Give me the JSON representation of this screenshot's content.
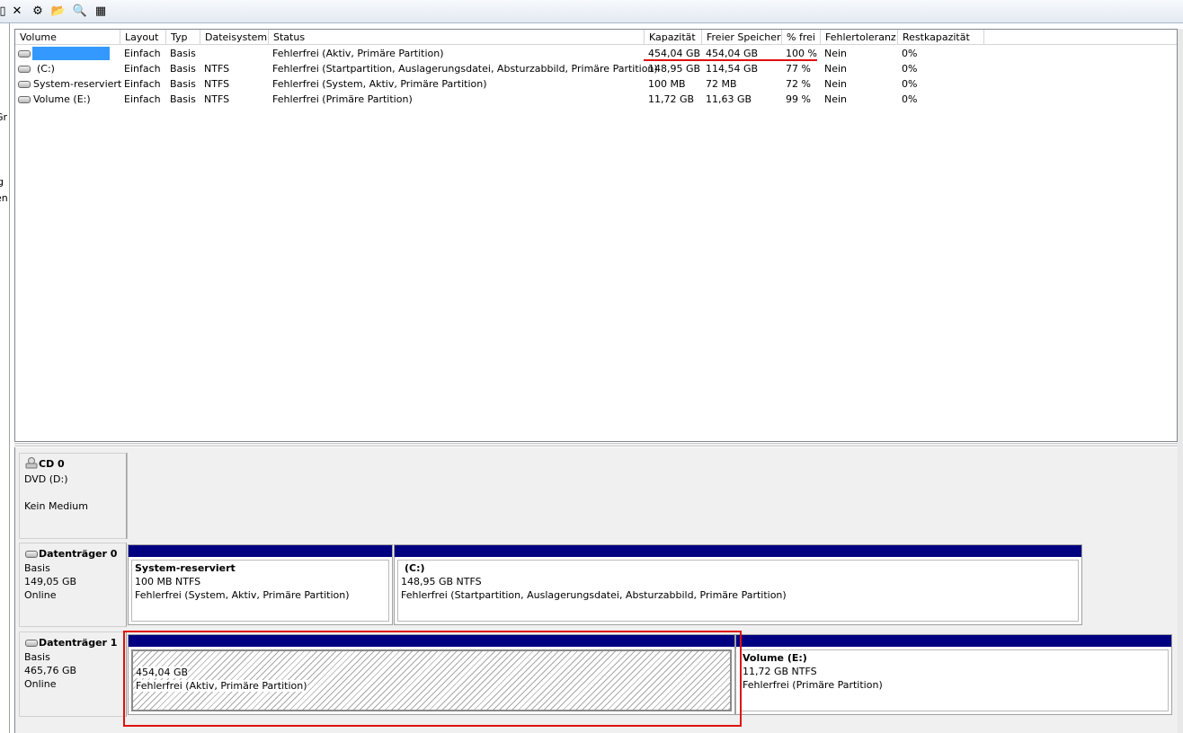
{
  "toolbar": {
    "buttons": [
      {
        "name": "properties",
        "icon": "properties-icon",
        "glyph": "▯"
      },
      {
        "name": "delete",
        "icon": "close-icon",
        "glyph": "✕"
      },
      {
        "name": "settings",
        "icon": "gear-icon",
        "glyph": "⚙"
      },
      {
        "name": "open",
        "icon": "folder-icon",
        "glyph": "📂"
      },
      {
        "name": "search",
        "icon": "search-icon",
        "glyph": "🔍"
      },
      {
        "name": "help",
        "icon": "help-icon",
        "glyph": "▦"
      }
    ]
  },
  "left_pane": {
    "fragments": [
      "Gr",
      "g",
      "en"
    ]
  },
  "volume_list": {
    "columns": [
      "Volume",
      "Layout",
      "Typ",
      "Dateisystem",
      "Status",
      "Kapazität",
      "Freier Speicher",
      "% frei",
      "Fehlertoleranz",
      "Restkapazität"
    ],
    "rows": [
      {
        "volume": "",
        "layout": "Einfach",
        "typ": "Basis",
        "dateisystem": "",
        "status": "Fehlerfrei (Aktiv, Primäre Partition)",
        "kapazitaet": "454,04 GB",
        "frei": "454,04 GB",
        "prozent": "100 %",
        "fehlertoleranz": "Nein",
        "rest": "0%"
      },
      {
        "volume": "(C:)",
        "layout": "Einfach",
        "typ": "Basis",
        "dateisystem": "NTFS",
        "status": "Fehlerfrei (Startpartition, Auslagerungsdatei, Absturzabbild, Primäre Partition)",
        "kapazitaet": "148,95 GB",
        "frei": "114,54 GB",
        "prozent": "77 %",
        "fehlertoleranz": "Nein",
        "rest": "0%"
      },
      {
        "volume": "System-reserviert",
        "layout": "Einfach",
        "typ": "Basis",
        "dateisystem": "NTFS",
        "status": "Fehlerfrei (System, Aktiv, Primäre Partition)",
        "kapazitaet": "100 MB",
        "frei": "72 MB",
        "prozent": "72 %",
        "fehlertoleranz": "Nein",
        "rest": "0%"
      },
      {
        "volume": "Volume (E:)",
        "layout": "Einfach",
        "typ": "Basis",
        "dateisystem": "NTFS",
        "status": "Fehlerfrei (Primäre Partition)",
        "kapazitaet": "11,72 GB",
        "frei": "11,63 GB",
        "prozent": "99 %",
        "fehlertoleranz": "Nein",
        "rest": "0%"
      }
    ]
  },
  "disks": {
    "cd0": {
      "name": "CD 0",
      "line1": "DVD (D:)",
      "line2": "Kein Medium"
    },
    "disk0": {
      "name": "Datenträger 0",
      "type": "Basis",
      "size": "149,05 GB",
      "state": "Online",
      "partitions": [
        {
          "title": "System-reserviert",
          "size": "100 MB NTFS",
          "status": "Fehlerfrei (System, Aktiv, Primäre Partition)"
        },
        {
          "title": "(C:)",
          "size": "148,95 GB NTFS",
          "status": "Fehlerfrei (Startpartition, Auslagerungsdatei, Absturzabbild, Primäre Partition)"
        }
      ]
    },
    "disk1": {
      "name": "Datenträger 1",
      "type": "Basis",
      "size": "465,76 GB",
      "state": "Online",
      "partitions": [
        {
          "title": "",
          "size": "454,04 GB",
          "status": "Fehlerfrei (Aktiv, Primäre Partition)"
        },
        {
          "title": "Volume  (E:)",
          "size": "11,72 GB NTFS",
          "status": "Fehlerfrei (Primäre Partition)"
        }
      ]
    }
  },
  "colors": {
    "partition_bar": "#000080",
    "selection": "#3399ff",
    "annotation_red": "#e01010"
  }
}
